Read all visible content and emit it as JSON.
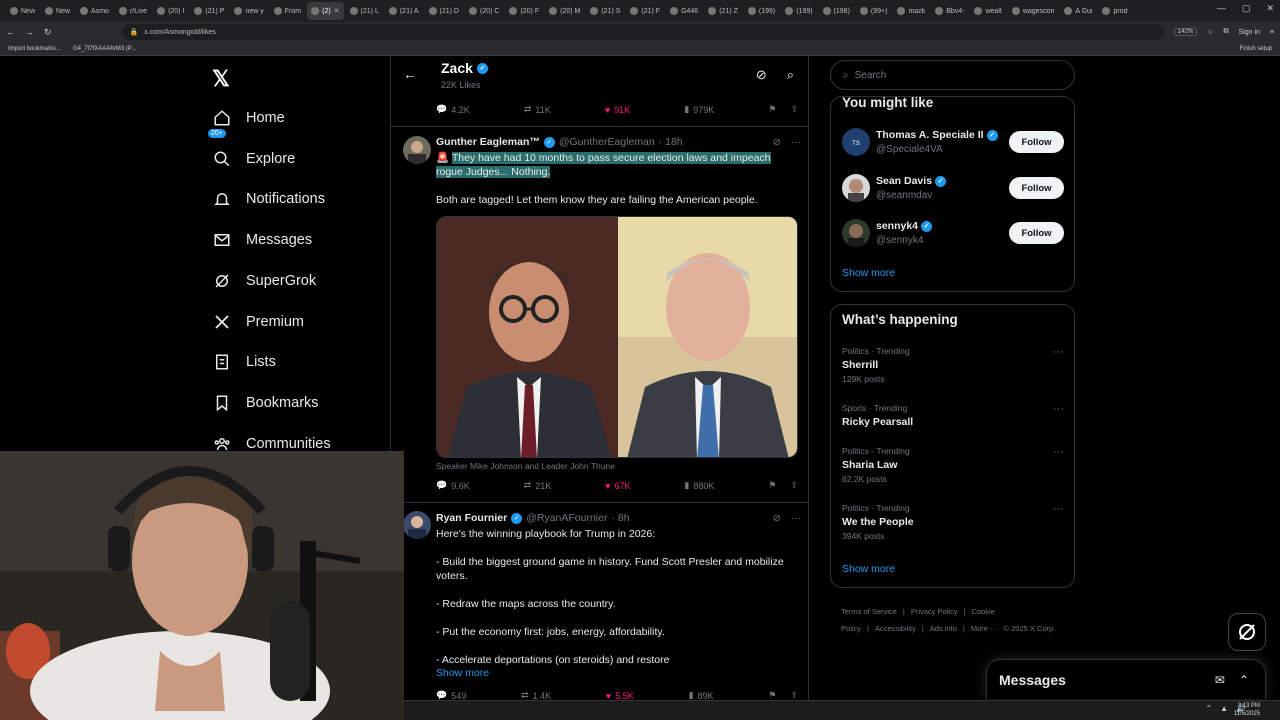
{
  "browser": {
    "tabs": [
      {
        "label": "New",
        "active": false
      },
      {
        "label": "New",
        "active": false
      },
      {
        "label": "Asmo",
        "active": false
      },
      {
        "label": "r/Live",
        "active": false
      },
      {
        "label": "(20) I",
        "active": false
      },
      {
        "label": "(21) P",
        "active": false
      },
      {
        "label": "new y",
        "active": false
      },
      {
        "label": "From",
        "active": false
      },
      {
        "label": "(2)",
        "active": true
      },
      {
        "label": "(21) L",
        "active": false
      },
      {
        "label": "(21) A",
        "active": false
      },
      {
        "label": "(21) D",
        "active": false
      },
      {
        "label": "(20) C",
        "active": false
      },
      {
        "label": "(20) F",
        "active": false
      },
      {
        "label": "(20) M",
        "active": false
      },
      {
        "label": "(21) S",
        "active": false
      },
      {
        "label": "(21) F",
        "active": false
      },
      {
        "label": "G446",
        "active": false
      },
      {
        "label": "(21) Z",
        "active": false
      },
      {
        "label": "(199)",
        "active": false
      },
      {
        "label": "(199)",
        "active": false
      },
      {
        "label": "(198)",
        "active": false
      },
      {
        "label": "(99+)",
        "active": false
      },
      {
        "label": "mazk",
        "active": false
      },
      {
        "label": "Bbv4-",
        "active": false
      },
      {
        "label": "wealt",
        "active": false
      },
      {
        "label": "wagescon",
        "active": false
      },
      {
        "label": "A Gui",
        "active": false
      },
      {
        "label": "prod",
        "active": false
      }
    ],
    "url": "x.com/Asmongold/likes",
    "zoom": "142%",
    "sign_in": "Sign in",
    "bookmarks": [
      "Import bookmarks...",
      "G4_7t7fXAAAhrM3 (P..."
    ],
    "finish_setup": "Finish setup"
  },
  "left_nav": {
    "items": [
      {
        "label": "Home",
        "icon": "home-icon"
      },
      {
        "label": "Explore",
        "icon": "search-icon"
      },
      {
        "label": "Notifications",
        "icon": "bell-icon"
      },
      {
        "label": "Messages",
        "icon": "envelope-icon"
      },
      {
        "label": "SuperGrok",
        "icon": "grok-icon"
      },
      {
        "label": "Premium",
        "icon": "x-icon"
      },
      {
        "label": "Lists",
        "icon": "list-icon"
      },
      {
        "label": "Bookmarks",
        "icon": "bookmark-icon"
      },
      {
        "label": "Communities",
        "icon": "communities-icon"
      }
    ],
    "notification_badge": "20+"
  },
  "profile_header": {
    "name": "Zack",
    "likes": "22K Likes"
  },
  "prev_tweet_actions": {
    "replies": "4.2K",
    "reposts": "11K",
    "likes": "91K",
    "views": "979K"
  },
  "tweet1": {
    "name": "Gunther Eagleman™",
    "handle": "@GuntherEagleman",
    "time": "· 18h",
    "emoji": "🚨",
    "highlighted_text": "They have had 10 months to pass secure election laws and impeach rogue Judges... Nothing.",
    "text2": "Both are tagged!  Let them know they are failing the American people.",
    "caption": "Speaker Mike Johnson and Leader John Thune",
    "replies": "9.6K",
    "reposts": "21K",
    "likes": "67K",
    "views": "880K"
  },
  "tweet2": {
    "name": "Ryan Fournier",
    "handle": "@RyanAFournier",
    "time": "· 8h",
    "lines": [
      "Here's the winning playbook for Trump in 2026:",
      "- Build the biggest ground game in history. Fund Scott Presler and mobilize voters.",
      "- Redraw the maps across the country.",
      "- Put the economy first: jobs, energy, affordability.",
      "- Accelerate deportations (on steroids) and restore"
    ],
    "show_more": "Show more",
    "replies": "549",
    "reposts": "1.4K",
    "likes": "5.5K",
    "views": "89K"
  },
  "right": {
    "search_placeholder": "Search",
    "you_might_like": "You might like",
    "suggestions": [
      {
        "name": "Thomas A. Speciale II",
        "handle": "@Speciale4VA",
        "button": "Follow"
      },
      {
        "name": "Sean Davis",
        "handle": "@seanmdav",
        "button": "Follow"
      },
      {
        "name": "sennyk4",
        "handle": "@sennyk4",
        "button": "Follow"
      }
    ],
    "show_more": "Show more",
    "whats_happening": "What’s happening",
    "trends": [
      {
        "category": "Politics · Trending",
        "title": "Sherrill",
        "count": "129K posts"
      },
      {
        "category": "Sports · Trending",
        "title": "Ricky Pearsall",
        "count": ""
      },
      {
        "category": "Politics · Trending",
        "title": "Sharia Law",
        "count": "62.2K posts"
      },
      {
        "category": "Politics · Trending",
        "title": "We the People",
        "count": "394K posts"
      }
    ],
    "show_more_2": "Show more",
    "footer": [
      "Terms of Service",
      "|",
      "Privacy Policy",
      "|",
      "Cookie Policy",
      "|",
      "Accessibility",
      "|",
      "Ads info",
      "|",
      "More ···",
      "© 2025 X Corp."
    ]
  },
  "messages_drawer": {
    "title": "Messages"
  },
  "taskbar": {
    "time": "3:13 PM",
    "date": "11/5/2025"
  },
  "colors": {
    "accent": "#1d9bf0",
    "like": "#f91880",
    "highlight": "#2a6d6c",
    "background": "#000000"
  }
}
